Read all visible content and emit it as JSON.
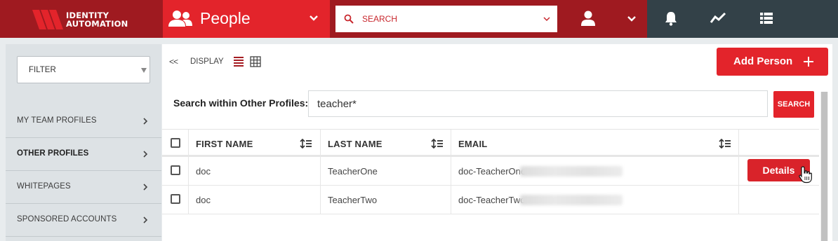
{
  "brand": {
    "logo_lines": [
      "IDENTITY",
      "AUTOMATION"
    ],
    "colors": {
      "dark_red": "#9f1a20",
      "red": "#e3242b",
      "slate": "#334148"
    }
  },
  "header": {
    "module_icon": "people-group-icon",
    "module_title": "People",
    "search_placeholder": "SEARCH",
    "user_icon": "user-icon",
    "tools": [
      "bell-icon",
      "trend-icon",
      "list-icon"
    ]
  },
  "sidebar": {
    "filter_label": "FILTER",
    "items": [
      {
        "label": "MY TEAM PROFILES",
        "active": false
      },
      {
        "label": "OTHER PROFILES",
        "active": true
      },
      {
        "label": "WHITEPAGES",
        "active": false
      },
      {
        "label": "SPONSORED ACCOUNTS",
        "active": false
      }
    ]
  },
  "toolbar": {
    "collapse_label": "<<",
    "display_label": "DISPLAY",
    "add_person_label": "Add Person"
  },
  "search_within": {
    "label": "Search within Other Profiles:",
    "value": "teacher*",
    "button_label": "SEARCH"
  },
  "table": {
    "columns": [
      "FIRST NAME",
      "LAST NAME",
      "EMAIL"
    ],
    "rows": [
      {
        "first": "doc",
        "last": "TeacherOne",
        "email": "doc-TeacherOne",
        "has_details": true
      },
      {
        "first": "doc",
        "last": "TeacherTwo",
        "email": "doc-TeacherTwo",
        "has_details": false
      }
    ],
    "details_label": "Details"
  }
}
